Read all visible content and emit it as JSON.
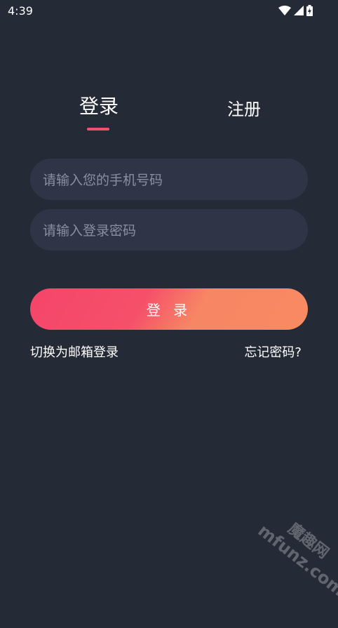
{
  "status_bar": {
    "time": "4:39",
    "icons": [
      "wifi-icon",
      "signal-icon",
      "battery-charging-icon"
    ]
  },
  "tabs": {
    "login": "登录",
    "register": "注册",
    "active": "login"
  },
  "form": {
    "phone_placeholder": "请输入您的手机号码",
    "password_placeholder": "请输入登录密码",
    "submit_label": "登 录"
  },
  "links": {
    "switch_email": "切换为邮箱登录",
    "forgot_password": "忘记密码?"
  },
  "watermark": {
    "brand": "魔趣网",
    "domain": "mfunz.com"
  },
  "colors": {
    "background": "#252a37",
    "input_background": "#2f3447",
    "accent": "#f0506e",
    "button_gradient_start": "#f5456a",
    "button_gradient_end": "#f88a62"
  }
}
